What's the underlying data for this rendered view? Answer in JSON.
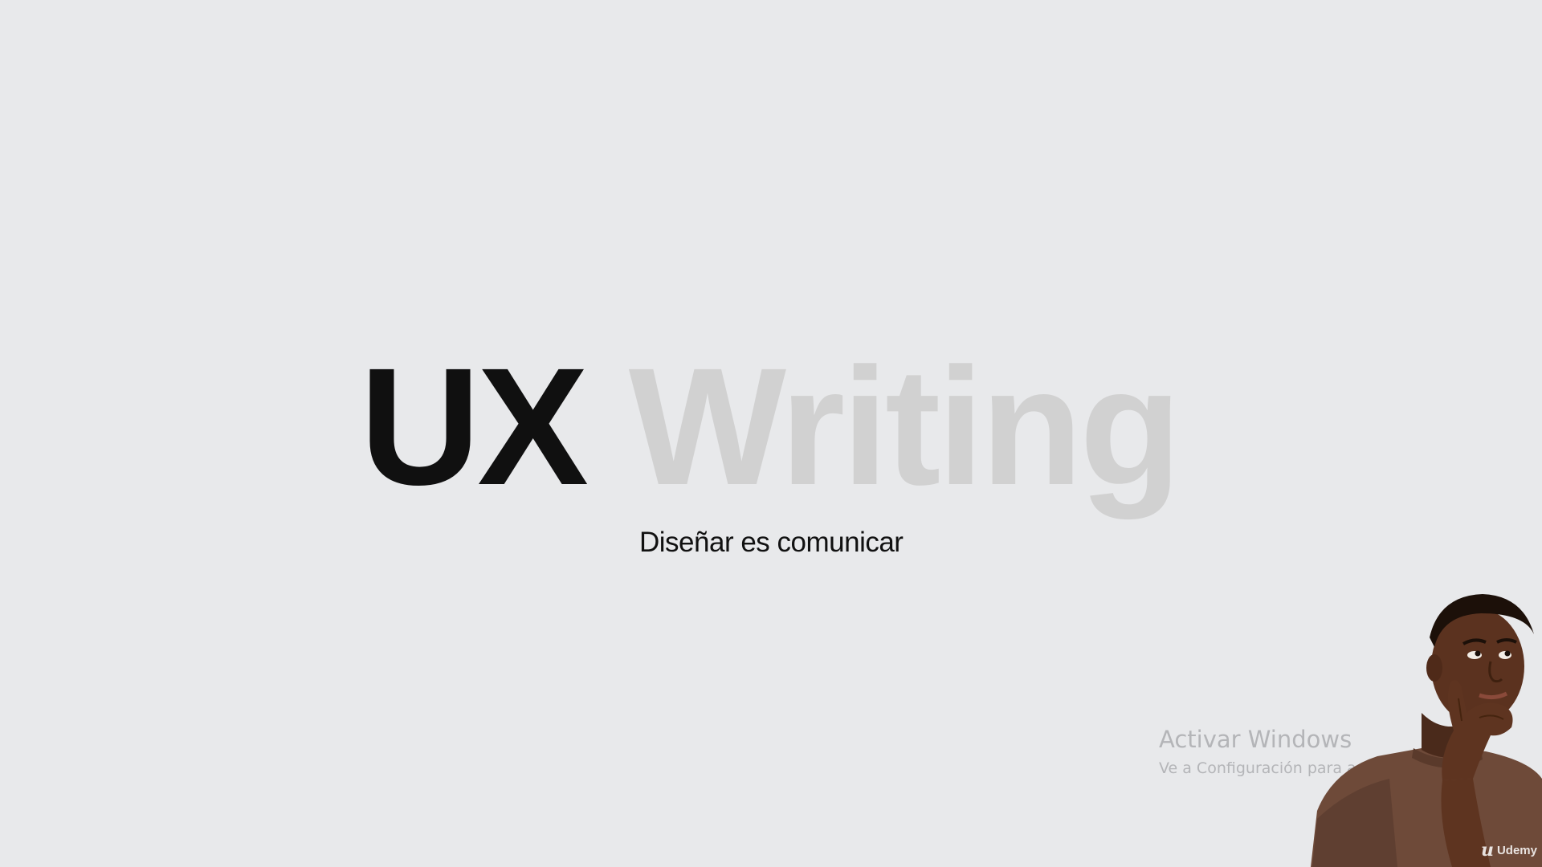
{
  "slide": {
    "title_dark": "UX",
    "title_light": "Writing",
    "subtitle": "Diseñar es comunicar",
    "colors": {
      "background": "#e8e9eb",
      "title_dark": "#101010",
      "title_light": "#d1d1d1",
      "subtitle": "#111111"
    }
  },
  "watermark": {
    "title": "Activar Windows",
    "subtitle": "Ve a Configuración para activar Windows."
  },
  "presenter": {
    "icon": "thinking-person-photo"
  },
  "brand": {
    "logo_icon": "udemy-u-logo-icon",
    "name": "Udemy"
  }
}
